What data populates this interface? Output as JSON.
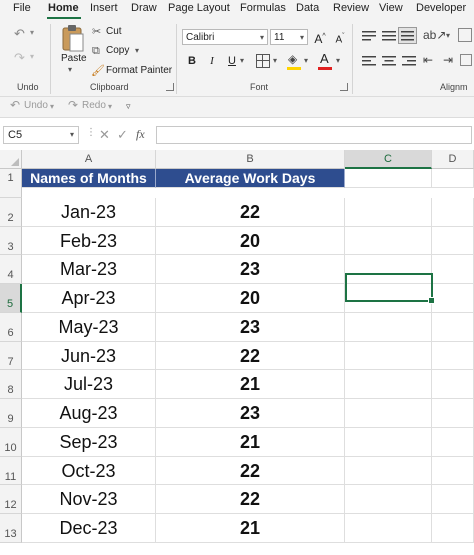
{
  "menu": {
    "tabs": [
      "File",
      "Home",
      "Insert",
      "Draw",
      "Page Layout",
      "Formulas",
      "Data",
      "Review",
      "View",
      "Developer"
    ],
    "active": "Home"
  },
  "ribbon": {
    "undo_group_label": "Undo",
    "clipboard": {
      "paste_label": "Paste",
      "cut_label": "Cut",
      "copy_label": "Copy",
      "format_painter_label": "Format Painter",
      "group_label": "Clipboard"
    },
    "font": {
      "name": "Calibri",
      "size": "11",
      "bold": "B",
      "italic": "I",
      "underline": "U",
      "group_label": "Font"
    },
    "alignment_group_label": "Alignm"
  },
  "quick_access": {
    "undo_label": "Undo",
    "redo_label": "Redo"
  },
  "formula_bar": {
    "name_box": "C5",
    "formula": ""
  },
  "columns": [
    "A",
    "B",
    "C",
    "D"
  ],
  "selected_cell": "C5",
  "table": {
    "headers": [
      "Names of Months",
      "Average Work Days"
    ],
    "rows": [
      [
        "Jan-23",
        "22"
      ],
      [
        "Feb-23",
        "20"
      ],
      [
        "Mar-23",
        "23"
      ],
      [
        "Apr-23",
        "20"
      ],
      [
        "May-23",
        "23"
      ],
      [
        "Jun-23",
        "22"
      ],
      [
        "Jul-23",
        "21"
      ],
      [
        "Aug-23",
        "23"
      ],
      [
        "Sep-23",
        "21"
      ],
      [
        "Oct-23",
        "22"
      ],
      [
        "Nov-23",
        "22"
      ],
      [
        "Dec-23",
        "21"
      ]
    ]
  },
  "colors": {
    "header_fill": "#2e4d8f",
    "accent_green": "#1d7344"
  }
}
